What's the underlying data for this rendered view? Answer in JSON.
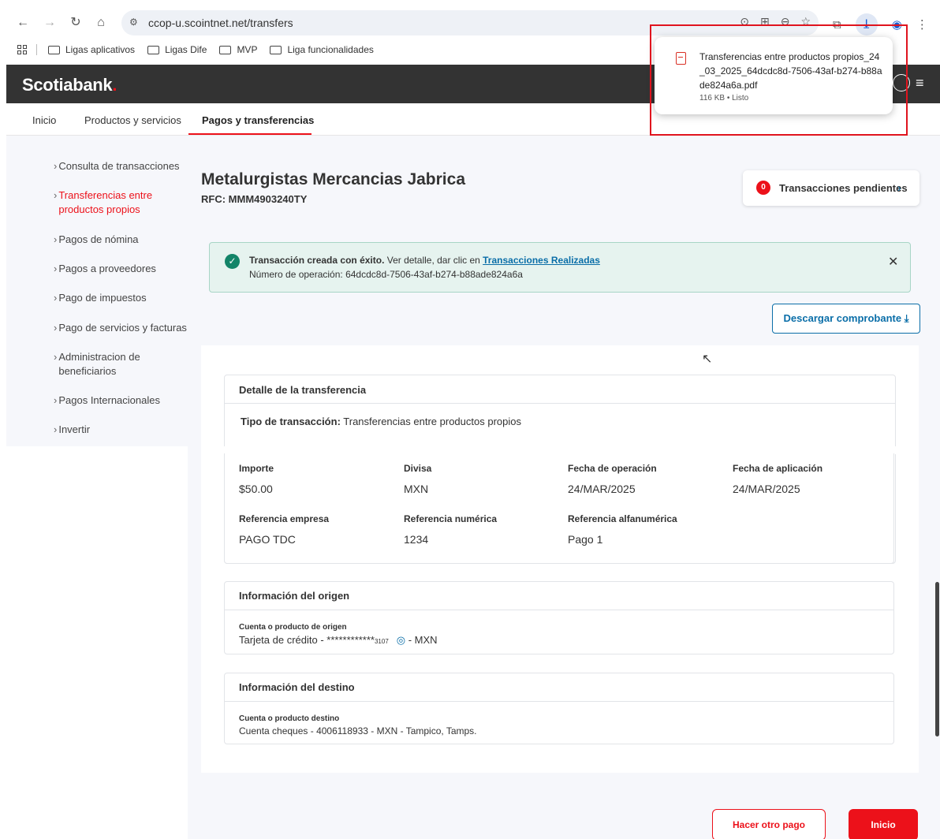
{
  "browser": {
    "url": "ccop-u.scointnet.net/transfers",
    "bookmarks": [
      "Ligas aplicativos",
      "Ligas Dife",
      "MVP",
      "Liga funcionalidades"
    ]
  },
  "download": {
    "filename": "Transferencias entre productos propios_24_03_2025_64dcdc8d-7506-43af-b274-b88ade824a6a.pdf",
    "meta": "116 KB • Listo"
  },
  "header": {
    "logo": "Scotiabank",
    "logo_dot": "."
  },
  "tabs": [
    "Inicio",
    "Productos y servicios",
    "Pagos y transferencias"
  ],
  "sidebar": {
    "items": [
      {
        "label": "Consulta de transacciones"
      },
      {
        "label": "Transferencias entre productos propios"
      },
      {
        "label": "Pagos de nómina"
      },
      {
        "label": "Pagos a proveedores"
      },
      {
        "label": "Pago de impuestos"
      },
      {
        "label": "Pago de servicios y facturas"
      },
      {
        "label": "Administracion de beneficiarios"
      },
      {
        "label": "Pagos Internacionales"
      },
      {
        "label": "Invertir"
      }
    ]
  },
  "company": {
    "name": "Metalurgistas Mercancias Jabrica",
    "rfc": "RFC: MMM4903240TY"
  },
  "pending": {
    "count": "0",
    "label": "Transacciones pendientes"
  },
  "alert": {
    "bold": "Transacción creada con éxito.",
    "text": " Ver detalle, dar clic en ",
    "link": "Transacciones Realizadas",
    "operation": "Número de operación: 64dcdc8d-7506-43af-b274-b88ade824a6a"
  },
  "download_receipt": "Descargar comprobante ⤓",
  "detail": {
    "title": "Detalle de la transferencia",
    "type_label": "Tipo de transacción:",
    "type_value": " Transferencias entre productos propios",
    "fields": {
      "importe_label": "Importe",
      "importe": "$50.00",
      "divisa_label": "Divisa",
      "divisa": "MXN",
      "fecha_op_label": "Fecha de operación",
      "fecha_op": "24/MAR/2025",
      "fecha_ap_label": "Fecha de aplicación",
      "fecha_ap": "24/MAR/2025",
      "ref_empresa_label": "Referencia empresa",
      "ref_empresa": "PAGO TDC",
      "ref_num_label": "Referencia numérica",
      "ref_num": "1234",
      "ref_alfa_label": "Referencia alfanumérica",
      "ref_alfa": "Pago 1"
    }
  },
  "origin": {
    "title": "Información del origen",
    "label": "Cuenta o producto de origen",
    "value_prefix": "Tarjeta de crédito - ************",
    "value_last4": "3107",
    "value_suffix": " - MXN"
  },
  "destination": {
    "title": "Información del destino",
    "label": "Cuenta o producto destino",
    "value": "Cuenta cheques - 4006118933 - MXN - Tampico, Tamps."
  },
  "buttons": {
    "other_payment": "Hacer otro pago",
    "home": "Inicio"
  }
}
